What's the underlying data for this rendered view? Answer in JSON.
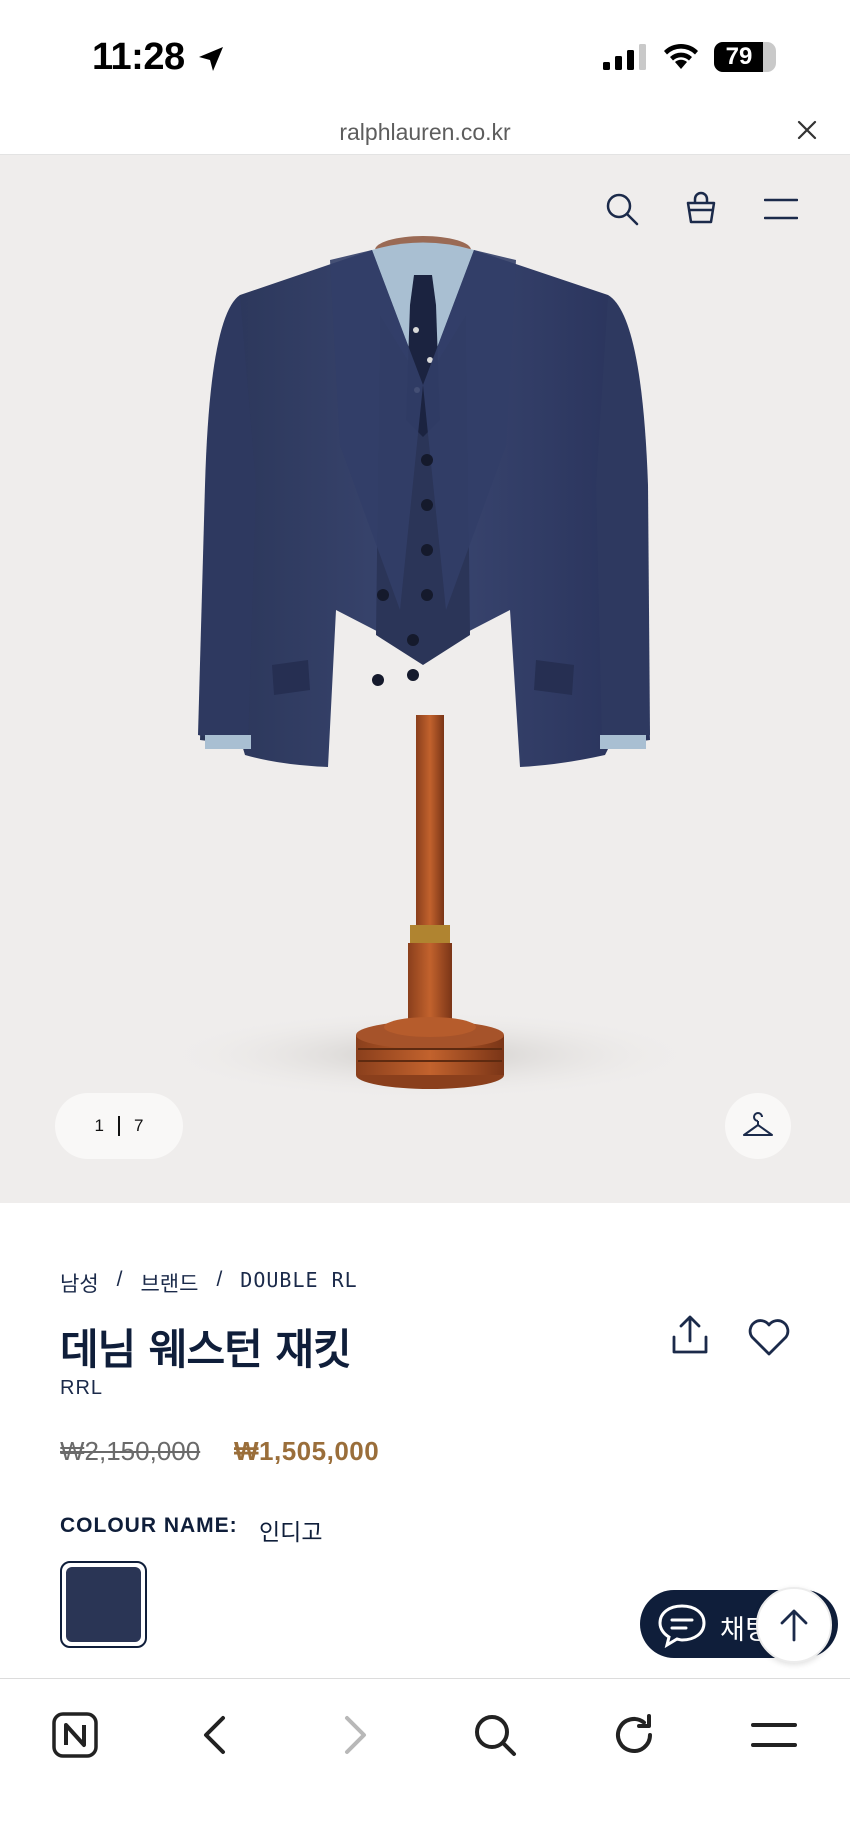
{
  "status_bar": {
    "time": "11:28",
    "battery": "79",
    "battery_level": 0.79,
    "icons": [
      "location-arrow-icon",
      "cellular-signal-icon",
      "wifi-icon",
      "battery-icon"
    ]
  },
  "browser": {
    "url": "ralphlauren.co.kr",
    "close_icon": "close-icon"
  },
  "site_header": {
    "icons": [
      "search-icon",
      "shopping-bag-icon",
      "menu-icon"
    ]
  },
  "gallery": {
    "current": "1",
    "total": "7",
    "hanger_icon": "hanger-icon"
  },
  "product": {
    "breadcrumb": [
      "남성",
      "/",
      "브랜드",
      "/",
      "DOUBLE RL"
    ],
    "title": "데님 웨스턴 재킷",
    "brand": "RRL",
    "price_original": "₩2,150,000",
    "price_sale": "₩1,505,000",
    "colour_label": "COLOUR NAME:",
    "colour_value": "인디고",
    "swatch_color": "#2a3555"
  },
  "colors": {
    "navy": "#0f1e3a",
    "sale_price": "#9a6e3a",
    "gallery_bg": "#efedec"
  },
  "chat": {
    "label": "채팅"
  },
  "bottom_nav": [
    "naver-home-icon",
    "back-icon",
    "forward-icon",
    "search-icon",
    "refresh-icon",
    "menu-icon"
  ]
}
